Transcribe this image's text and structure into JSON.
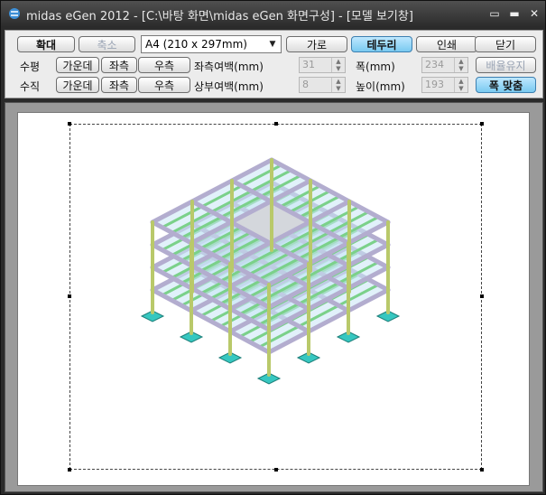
{
  "titlebar": {
    "title": "midas eGen  2012 - [C:\\바탕 화면\\midas eGen 화면구성] - [모델 보기창]",
    "icons": [
      "app-icon",
      "restore-icon",
      "minimize-icon",
      "close-icon"
    ]
  },
  "toolbar": {
    "zoom_in": "확대",
    "zoom_out": "축소",
    "paper_size": "A4 (210 x 297mm)",
    "landscape": "가로",
    "border": "테두리",
    "print": "인쇄",
    "close": "닫기",
    "horizontal_label": "수평",
    "vertical_label": "수직",
    "center": "가운데",
    "left": "좌측",
    "right": "우측",
    "left_margin_label": "좌측여백(mm)",
    "top_margin_label": "상부여백(mm)",
    "left_margin_value": "31",
    "top_margin_value": "8",
    "width_label": "폭(mm)",
    "height_label": "높이(mm)",
    "width_value": "234",
    "height_value": "193",
    "keep_ratio": "배율유지",
    "fit_width": "폭 맞춤"
  },
  "colors": {
    "active_button": "#7dcaf0",
    "beam": "#b3adcf",
    "column": "#b9c96a",
    "slab_beam_green": "#7bd18a",
    "footing": "#36c7c0"
  }
}
